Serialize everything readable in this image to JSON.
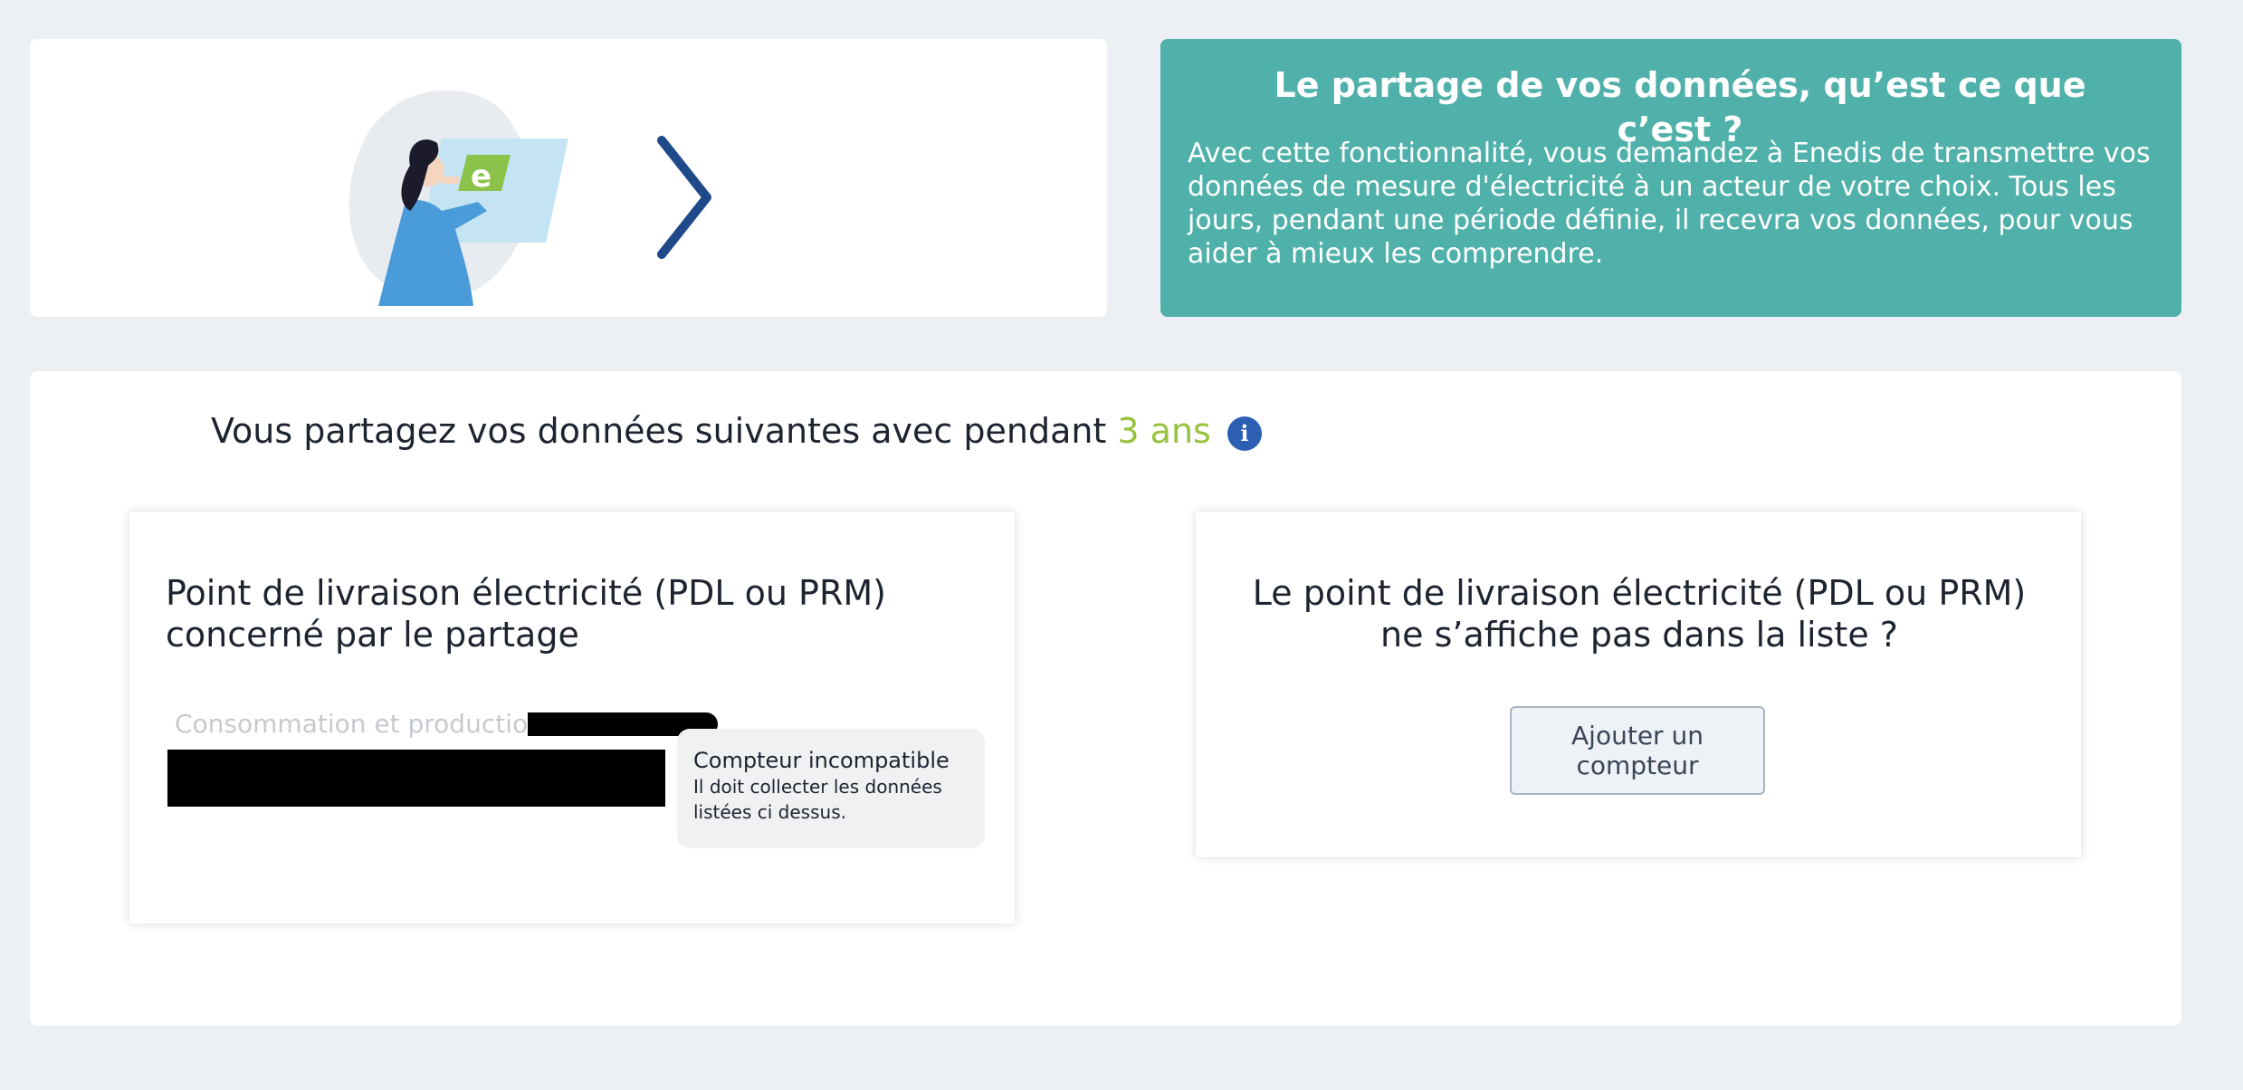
{
  "info": {
    "title": "Le partage de vos données, qu’est ce que c’est ?",
    "text": "Avec cette fonctionnalité, vous demandez à Enedis de transmettre vos données de mesure d'électricité à un acteur de votre choix. Tous les jours, pendant une période définie, il recevra vos données, pour vous aider à mieux les comprendre."
  },
  "share": {
    "heading": "Vous partagez vos données suivantes avec pendant ",
    "duration": "3 ans",
    "info_icon": "i"
  },
  "pdl_panel": {
    "title": "Point de livraison électricité (PDL ou PRM) concerné par le partage",
    "meter_type": "Consommation et production -",
    "tooltip_title": "Compteur incompatible",
    "tooltip_text": "Il doit collecter les données listées ci dessus."
  },
  "add_panel": {
    "title": "Le point de livraison électricité (PDL ou PRM) ne s’affiche pas dans la liste ?",
    "button_label": "Ajouter un compteur"
  },
  "colors": {
    "info_bg": "#50b1aa",
    "accent_green": "#96c23d",
    "info_icon_blue": "#2c5fb3",
    "chevron": "#1e4a8a"
  },
  "icons": {
    "next": "chevron-right-icon",
    "illustration": "person-holding-enedis-card-illustration"
  }
}
